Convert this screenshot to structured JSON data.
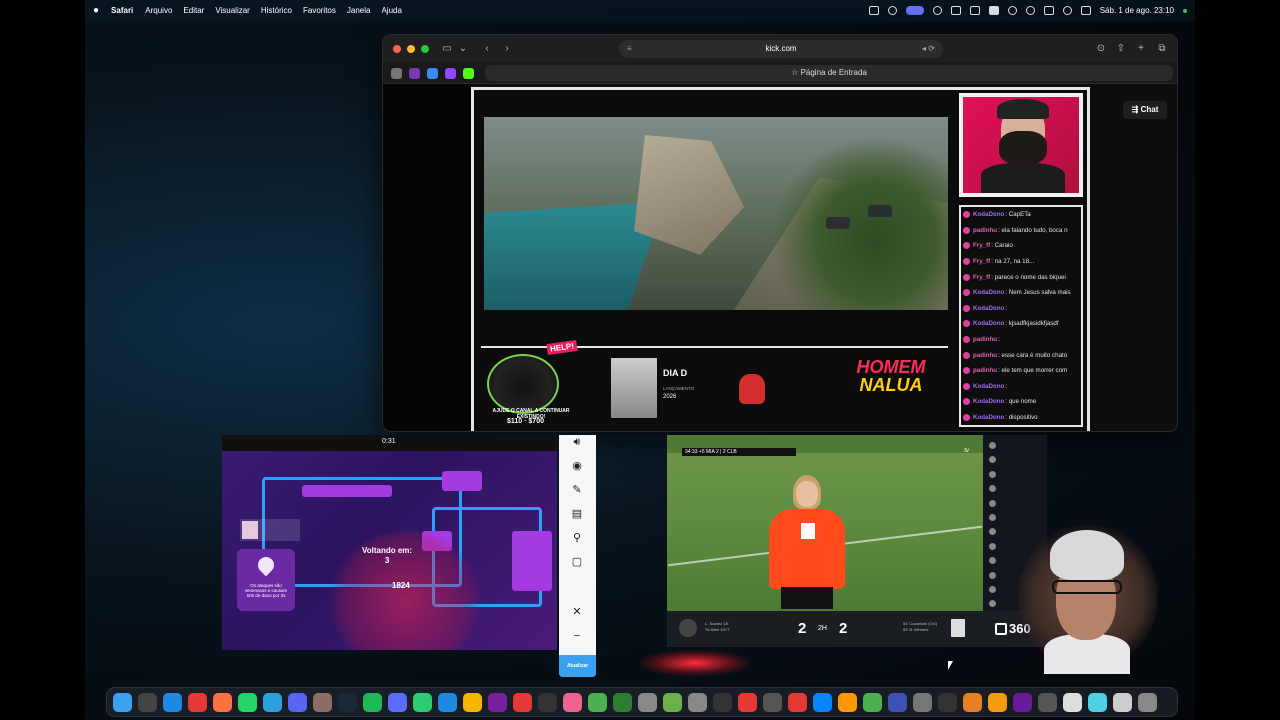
{
  "menubar": {
    "apple": "",
    "app": "Safari",
    "menus": [
      "Arquivo",
      "Editar",
      "Visualizar",
      "Histórico",
      "Favoritos",
      "Janela",
      "Ajuda"
    ],
    "datetime": "Sáb. 1 de ago. 23:10"
  },
  "safari": {
    "url": "kick.com",
    "tab_title": "Página de Entrada",
    "chat_button": "Chat"
  },
  "stream": {
    "chat": [
      {
        "user": "KodaDono",
        "msg": ": CapETa",
        "color": "#a06df0",
        "icon": "#e040a0"
      },
      {
        "user": "padinhu",
        "msg": ": ela falando tudo, boca n",
        "color": "#e060b0",
        "icon": "#e040a0"
      },
      {
        "user": "Fry_ff",
        "msg": ": Caraio",
        "color": "#e060b0",
        "icon": "#e040a0"
      },
      {
        "user": "Fry_ff",
        "msg": ": na 27, na 18...",
        "color": "#e060b0",
        "icon": "#e040a0"
      },
      {
        "user": "Fry_ff",
        "msg": ": parece o nome das biquei",
        "color": "#e060b0",
        "icon": "#e040a0"
      },
      {
        "user": "KodaDono",
        "msg": ": Nem Jesus salva mais",
        "color": "#a06df0",
        "icon": "#e040a0"
      },
      {
        "user": "KodaDono",
        "msg": ":",
        "color": "#a06df0",
        "icon": "#e040a0"
      },
      {
        "user": "KodaDono",
        "msg": ": kjsadfkjasidkfjasdf",
        "color": "#a06df0",
        "icon": "#e040a0"
      },
      {
        "user": "padinhu",
        "msg": ":",
        "color": "#e060b0",
        "icon": "#e040a0"
      },
      {
        "user": "padinhu",
        "msg": ": esse cara é muito chato",
        "color": "#e060b0",
        "icon": "#e040a0"
      },
      {
        "user": "padinhu",
        "msg": ": ele tem que morrer com",
        "color": "#e060b0",
        "icon": "#e040a0"
      },
      {
        "user": "KodaDono",
        "msg": ":",
        "color": "#a06df0",
        "icon": "#e040a0"
      },
      {
        "user": "KodaDono",
        "msg": ": que nome",
        "color": "#a06df0",
        "icon": "#e040a0"
      },
      {
        "user": "KodaDono",
        "msg": ": dispositivo",
        "color": "#a06df0",
        "icon": "#e040a0"
      }
    ],
    "banner": {
      "help": "HELP!",
      "ajude": "AJUDE O CANAL A CONTINUAR EXISTINDO!",
      "price": "$110 · $700",
      "movie_title": "DIA D",
      "lancamento": "LANÇAMENTO",
      "year": "2026",
      "homem": "HOMEM",
      "nalua": "NALUA"
    }
  },
  "game": {
    "timer": "0:31",
    "respawn": "Voltando em:",
    "respawn_count": "3",
    "score": "1824",
    "tip": "Os ataques são venenosos e causam 500 de dano por 3s"
  },
  "sidepanel": {
    "update_label": "Atualizar"
  },
  "soccer": {
    "hud": "94:33 +5   MIA  2 | 2  CLB",
    "provider": "tv",
    "home_score": "2",
    "away_score": "2",
    "period": "2H",
    "home_scorers": "L. Suárez 18'\n76 Allen 43+7'",
    "away_scorers": "54' Cucarinini (OG)\n83' B. Méndez",
    "tv360": "360"
  }
}
